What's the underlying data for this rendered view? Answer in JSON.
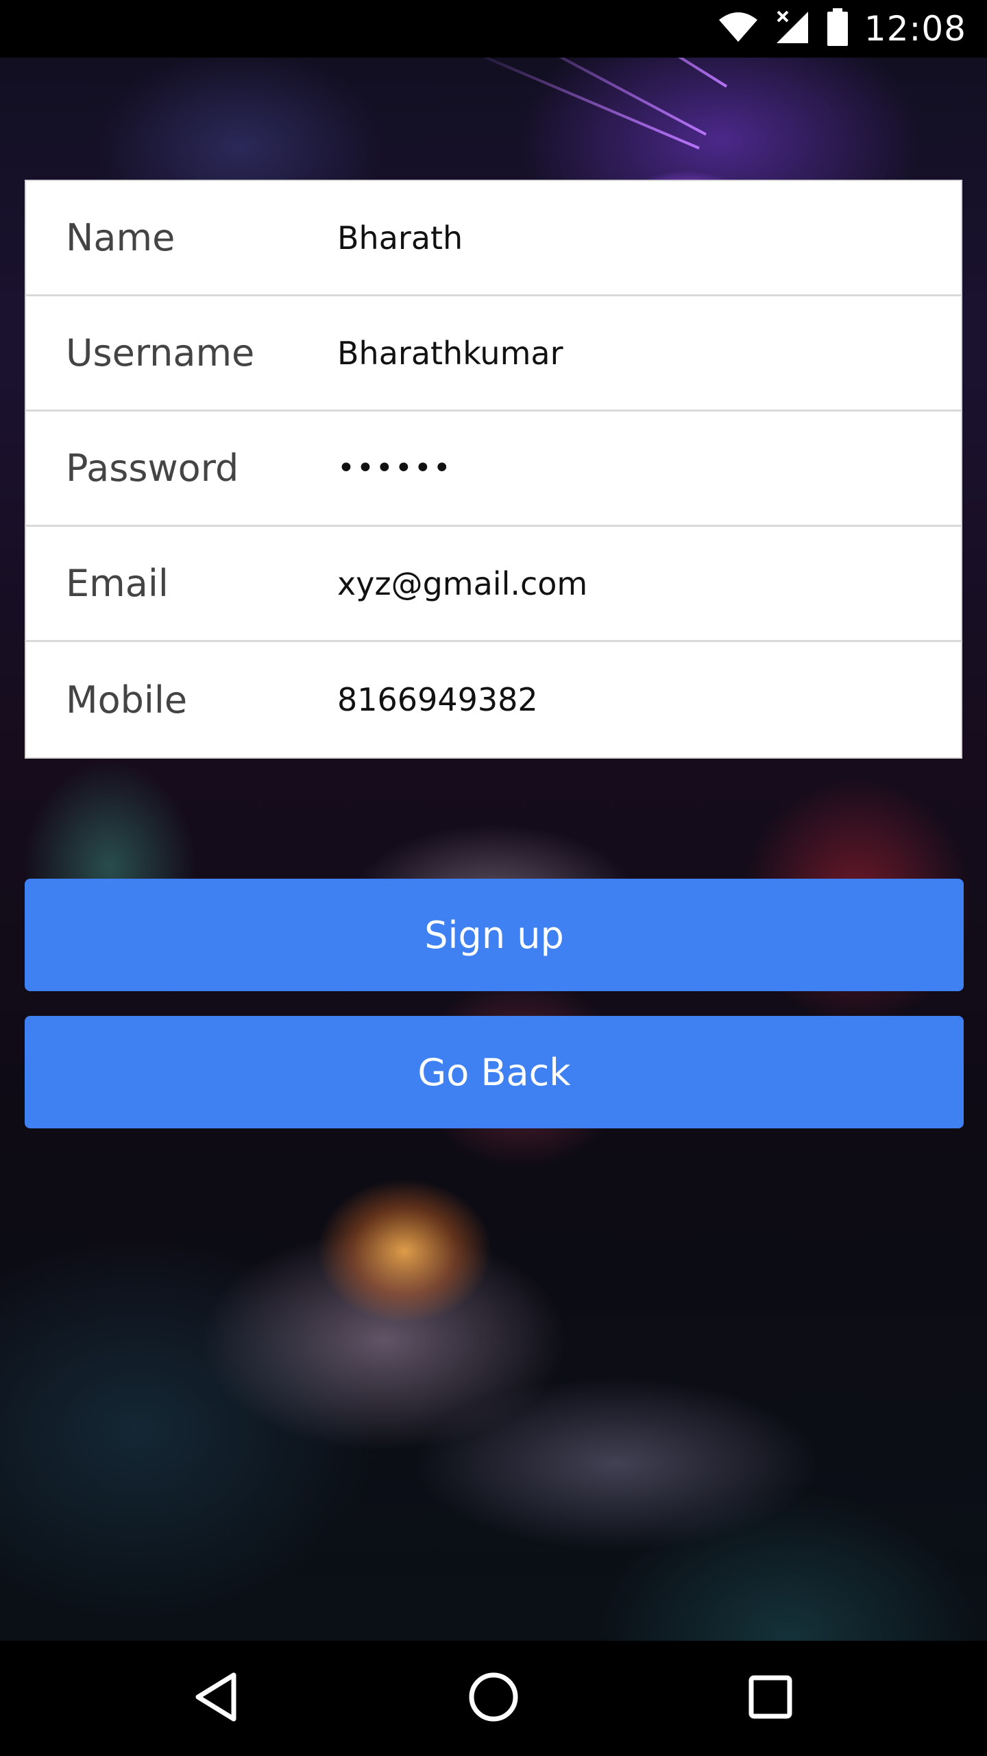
{
  "status_bar": {
    "time": "12:08",
    "icons": [
      "wifi-icon",
      "cell-signal-icon",
      "battery-icon"
    ]
  },
  "form": {
    "fields": [
      {
        "label": "Name",
        "value": "Bharath",
        "type": "text"
      },
      {
        "label": "Username",
        "value": "Bharathkumar",
        "type": "text"
      },
      {
        "label": "Password",
        "value": "••••••",
        "type": "password"
      },
      {
        "label": "Email",
        "value": "xyz@gmail.com",
        "type": "email"
      },
      {
        "label": "Mobile",
        "value": "8166949382",
        "type": "tel"
      }
    ]
  },
  "actions": {
    "signup_label": "Sign up",
    "back_label": "Go Back"
  },
  "nav_bar": {
    "icons": [
      "back-triangle-icon",
      "home-circle-icon",
      "recents-square-icon"
    ]
  },
  "colors": {
    "button": "#3f80f2",
    "card": "#ffffff",
    "divider": "#d9d9d9"
  }
}
